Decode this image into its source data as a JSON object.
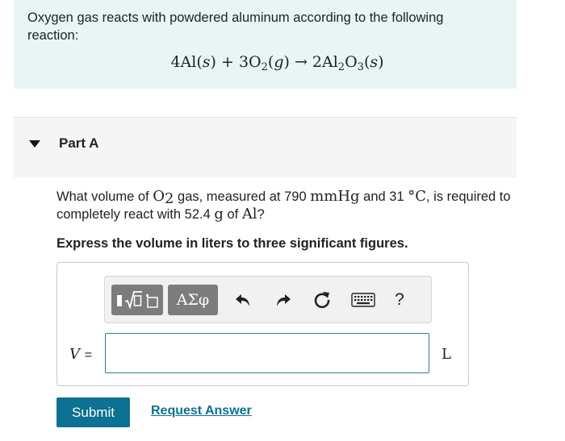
{
  "intro": {
    "text": "Oxygen gas reacts with powdered aluminum according to the following reaction:",
    "equation": {
      "coef_al": "4Al",
      "state_s": "s",
      "plus": "+",
      "coef_o2": "3O",
      "sub_2": "2",
      "state_g": "g",
      "arrow": "→",
      "product_a": "2Al",
      "sub_2b": "2",
      "product_b": "O",
      "sub_3": "3"
    }
  },
  "part": {
    "title": "Part A"
  },
  "question": {
    "pre": "What volume of ",
    "o": "O",
    "o_sub": "2",
    "mid1": " gas, measured at 790 ",
    "mmhg": "mmHg",
    "mid2": " and 31 ",
    "deg": "°C",
    "mid3": ", is required to completely react with 52.4 ",
    "g": "g",
    "mid4": " of ",
    "al": "Al",
    "end": "?"
  },
  "instruction": "Express the volume in liters to three significant figures.",
  "toolbar": {
    "greek_label": "ΑΣφ",
    "help_label": "?"
  },
  "answer": {
    "variable": "V",
    "equals": "=",
    "value": "",
    "unit": "L"
  },
  "actions": {
    "submit_label": "Submit",
    "request_label": "Request Answer"
  }
}
